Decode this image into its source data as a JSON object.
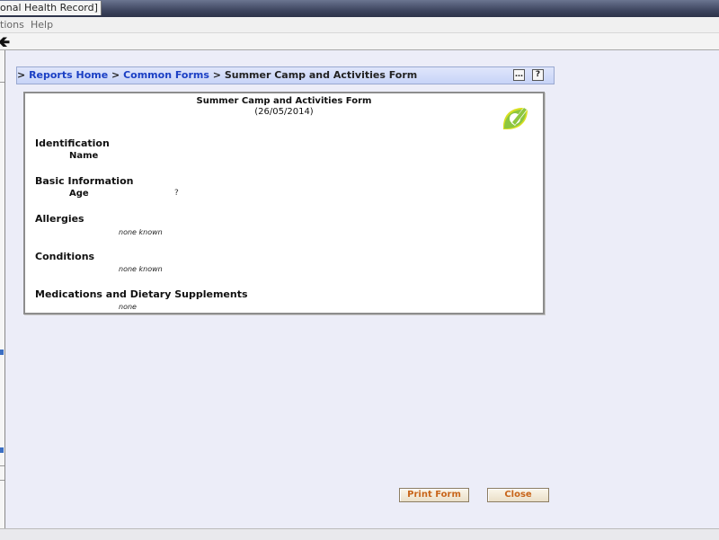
{
  "window": {
    "title": "onal Health Record]"
  },
  "menu": {
    "items": [
      "tions",
      "Help"
    ]
  },
  "breadcrumb": {
    "prefix": ">",
    "items": [
      {
        "label": "Reports Home"
      },
      {
        "label": "Common Forms"
      }
    ],
    "separator": ">",
    "current": "Summer Camp and Activities Form",
    "collapse_glyph": "…",
    "help_glyph": "?"
  },
  "form": {
    "title": "Summer Camp and Activities Form",
    "date": "(26/05/2014)",
    "logo_icon": "leaf-pencil-icon",
    "sections": {
      "identification": {
        "heading": "Identification",
        "name_label": "Name"
      },
      "basic_info": {
        "heading": "Basic Information",
        "age_label": "Age",
        "age_value": "?"
      },
      "allergies": {
        "heading": "Allergies",
        "value": "none known"
      },
      "conditions": {
        "heading": "Conditions",
        "value": "none known"
      },
      "medications": {
        "heading": "Medications and Dietary Supplements",
        "value": "none"
      }
    }
  },
  "buttons": {
    "print_label": "Print Form",
    "close_label": "Close"
  },
  "colors": {
    "link": "#1a3fc4",
    "button_text": "#c8651a",
    "logo_green": "#8dc63f",
    "logo_yellow": "#d9e021"
  }
}
